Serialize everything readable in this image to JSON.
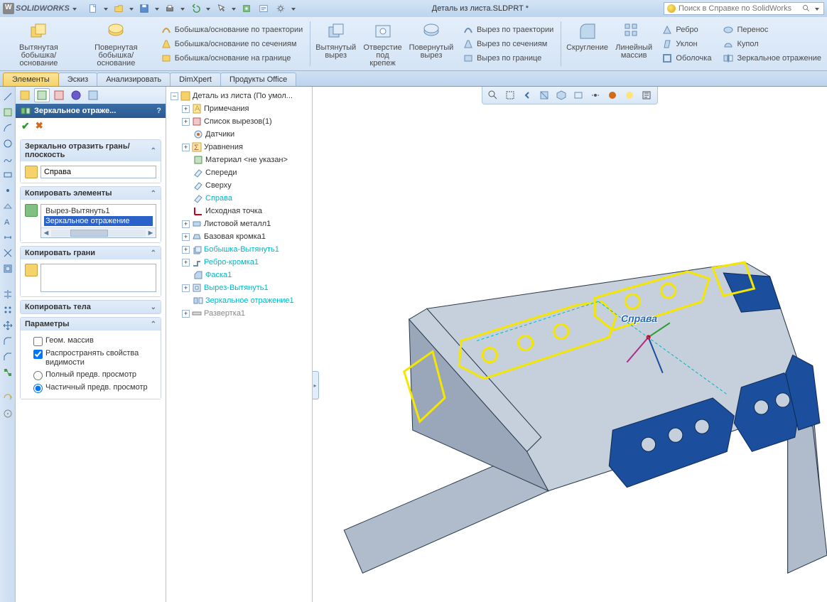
{
  "app": {
    "name": "SOLIDWORKS",
    "doc_title": "Деталь из листа.SLDPRT *",
    "search_placeholder": "Поиск в Справке по SolidWorks"
  },
  "ribbon": {
    "extruded_boss": "Вытянутая\nбобышка/основание",
    "revolved_boss": "Повернутая\nбобышка/основание",
    "swept_boss": "Бобышка/основание по траектории",
    "lofted_boss": "Бобышка/основание по сечениям",
    "boundary_boss": "Бобышка/основание на границе",
    "extruded_cut": "Вытянутый\nвырез",
    "hole_wizard": "Отверстие\nпод\nкрепеж",
    "revolved_cut": "Повернутый\nвырез",
    "swept_cut": "Вырез по траектории",
    "lofted_cut": "Вырез по сечениям",
    "boundary_cut": "Вырез по границе",
    "fillet": "Скругление",
    "linear_pattern": "Линейный\nмассив",
    "rib": "Ребро",
    "draft": "Уклон",
    "shell": "Оболочка",
    "wrap": "Перенос",
    "dome": "Купол",
    "mirror": "Зеркальное отражение"
  },
  "tabs": [
    "Элементы",
    "Эскиз",
    "Анализировать",
    "DimXpert",
    "Продукты Office"
  ],
  "active_tab": 0,
  "pm": {
    "title": "Зеркальное отраже...",
    "groups": {
      "mirror_face": {
        "header": "Зеркально отразить грань/плоскость",
        "value": "Справа"
      },
      "features_to_mirror": {
        "header": "Копировать элементы",
        "items": [
          "Вырез-Вытянуть1",
          "Зеркальное отражение"
        ]
      },
      "faces_to_mirror": {
        "header": "Копировать грани"
      },
      "bodies_to_mirror": {
        "header": "Копировать тела"
      },
      "options": {
        "header": "Параметры",
        "geom_pattern": "Геом. массив",
        "propagate": "Распространять свойства видимости",
        "full_preview": "Полный предв. просмотр",
        "partial_preview": "Частичный предв. просмотр"
      }
    }
  },
  "tree": {
    "root": "Деталь из листа  (По умол...",
    "items": [
      {
        "label": "Примечания",
        "icon": "notes",
        "lvl": 1,
        "exp": "+"
      },
      {
        "label": "Список вырезов(1)",
        "icon": "cutlist",
        "lvl": 1,
        "exp": "+"
      },
      {
        "label": "Датчики",
        "icon": "sensors",
        "lvl": 1
      },
      {
        "label": "Уравнения",
        "icon": "equations",
        "lvl": 1,
        "exp": "+"
      },
      {
        "label": "Материал <не указан>",
        "icon": "material",
        "lvl": 1
      },
      {
        "label": "Спереди",
        "icon": "plane",
        "lvl": 1
      },
      {
        "label": "Сверху",
        "icon": "plane",
        "lvl": 1
      },
      {
        "label": "Справа",
        "icon": "plane",
        "lvl": 1,
        "sel": true
      },
      {
        "label": "Исходная точка",
        "icon": "origin",
        "lvl": 1
      },
      {
        "label": "Листовой металл1",
        "icon": "sheetmetal",
        "lvl": 1,
        "exp": "+"
      },
      {
        "label": "Базовая кромка1",
        "icon": "baseflange",
        "lvl": 1,
        "exp": "+"
      },
      {
        "label": "Бобышка-Вытянуть1",
        "icon": "extrude",
        "lvl": 1,
        "exp": "+",
        "sel": true
      },
      {
        "label": "Ребро-кромка1",
        "icon": "edgeflange",
        "lvl": 1,
        "exp": "+",
        "sel": true
      },
      {
        "label": "Фаска1",
        "icon": "chamfer",
        "lvl": 1,
        "sel": true
      },
      {
        "label": "Вырез-Вытянуть1",
        "icon": "cut",
        "lvl": 1,
        "exp": "+",
        "sel": true
      },
      {
        "label": "Зеркальное отражение1",
        "icon": "mirror",
        "lvl": 1,
        "sel": true
      },
      {
        "label": "Развертка1",
        "icon": "flatten",
        "lvl": 1,
        "exp": "+",
        "dim": true
      }
    ]
  },
  "viewport": {
    "plane_label": "Справа"
  }
}
